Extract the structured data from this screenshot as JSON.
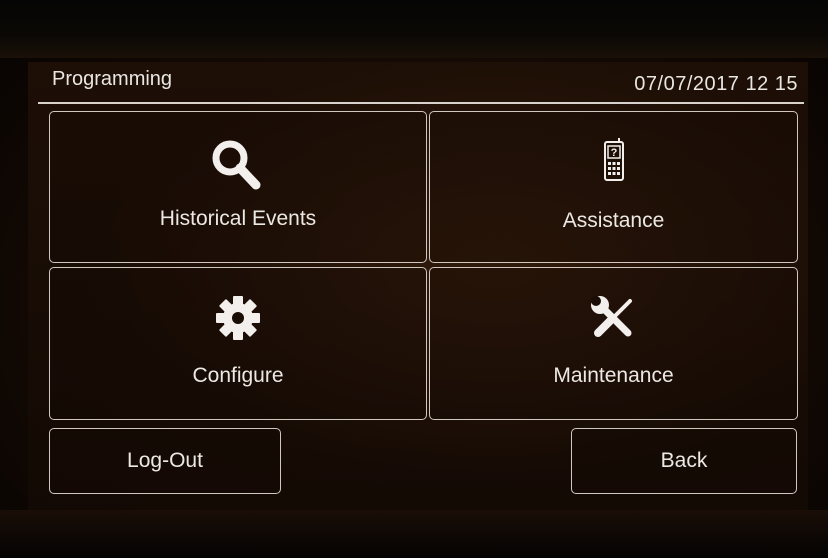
{
  "header": {
    "title": "Programming",
    "datetime": "07/07/2017 12 15"
  },
  "tiles": [
    {
      "label": "Historical Events",
      "icon": "search-icon"
    },
    {
      "label": "Assistance",
      "icon": "phone-help-icon"
    },
    {
      "label": "Configure",
      "icon": "gear-icon"
    },
    {
      "label": "Maintenance",
      "icon": "tools-icon"
    }
  ],
  "footer": {
    "logout_label": "Log-Out",
    "back_label": "Back"
  },
  "colors": {
    "text": "#ece8e4",
    "border": "#cfc7c0",
    "background": "#170c05"
  }
}
